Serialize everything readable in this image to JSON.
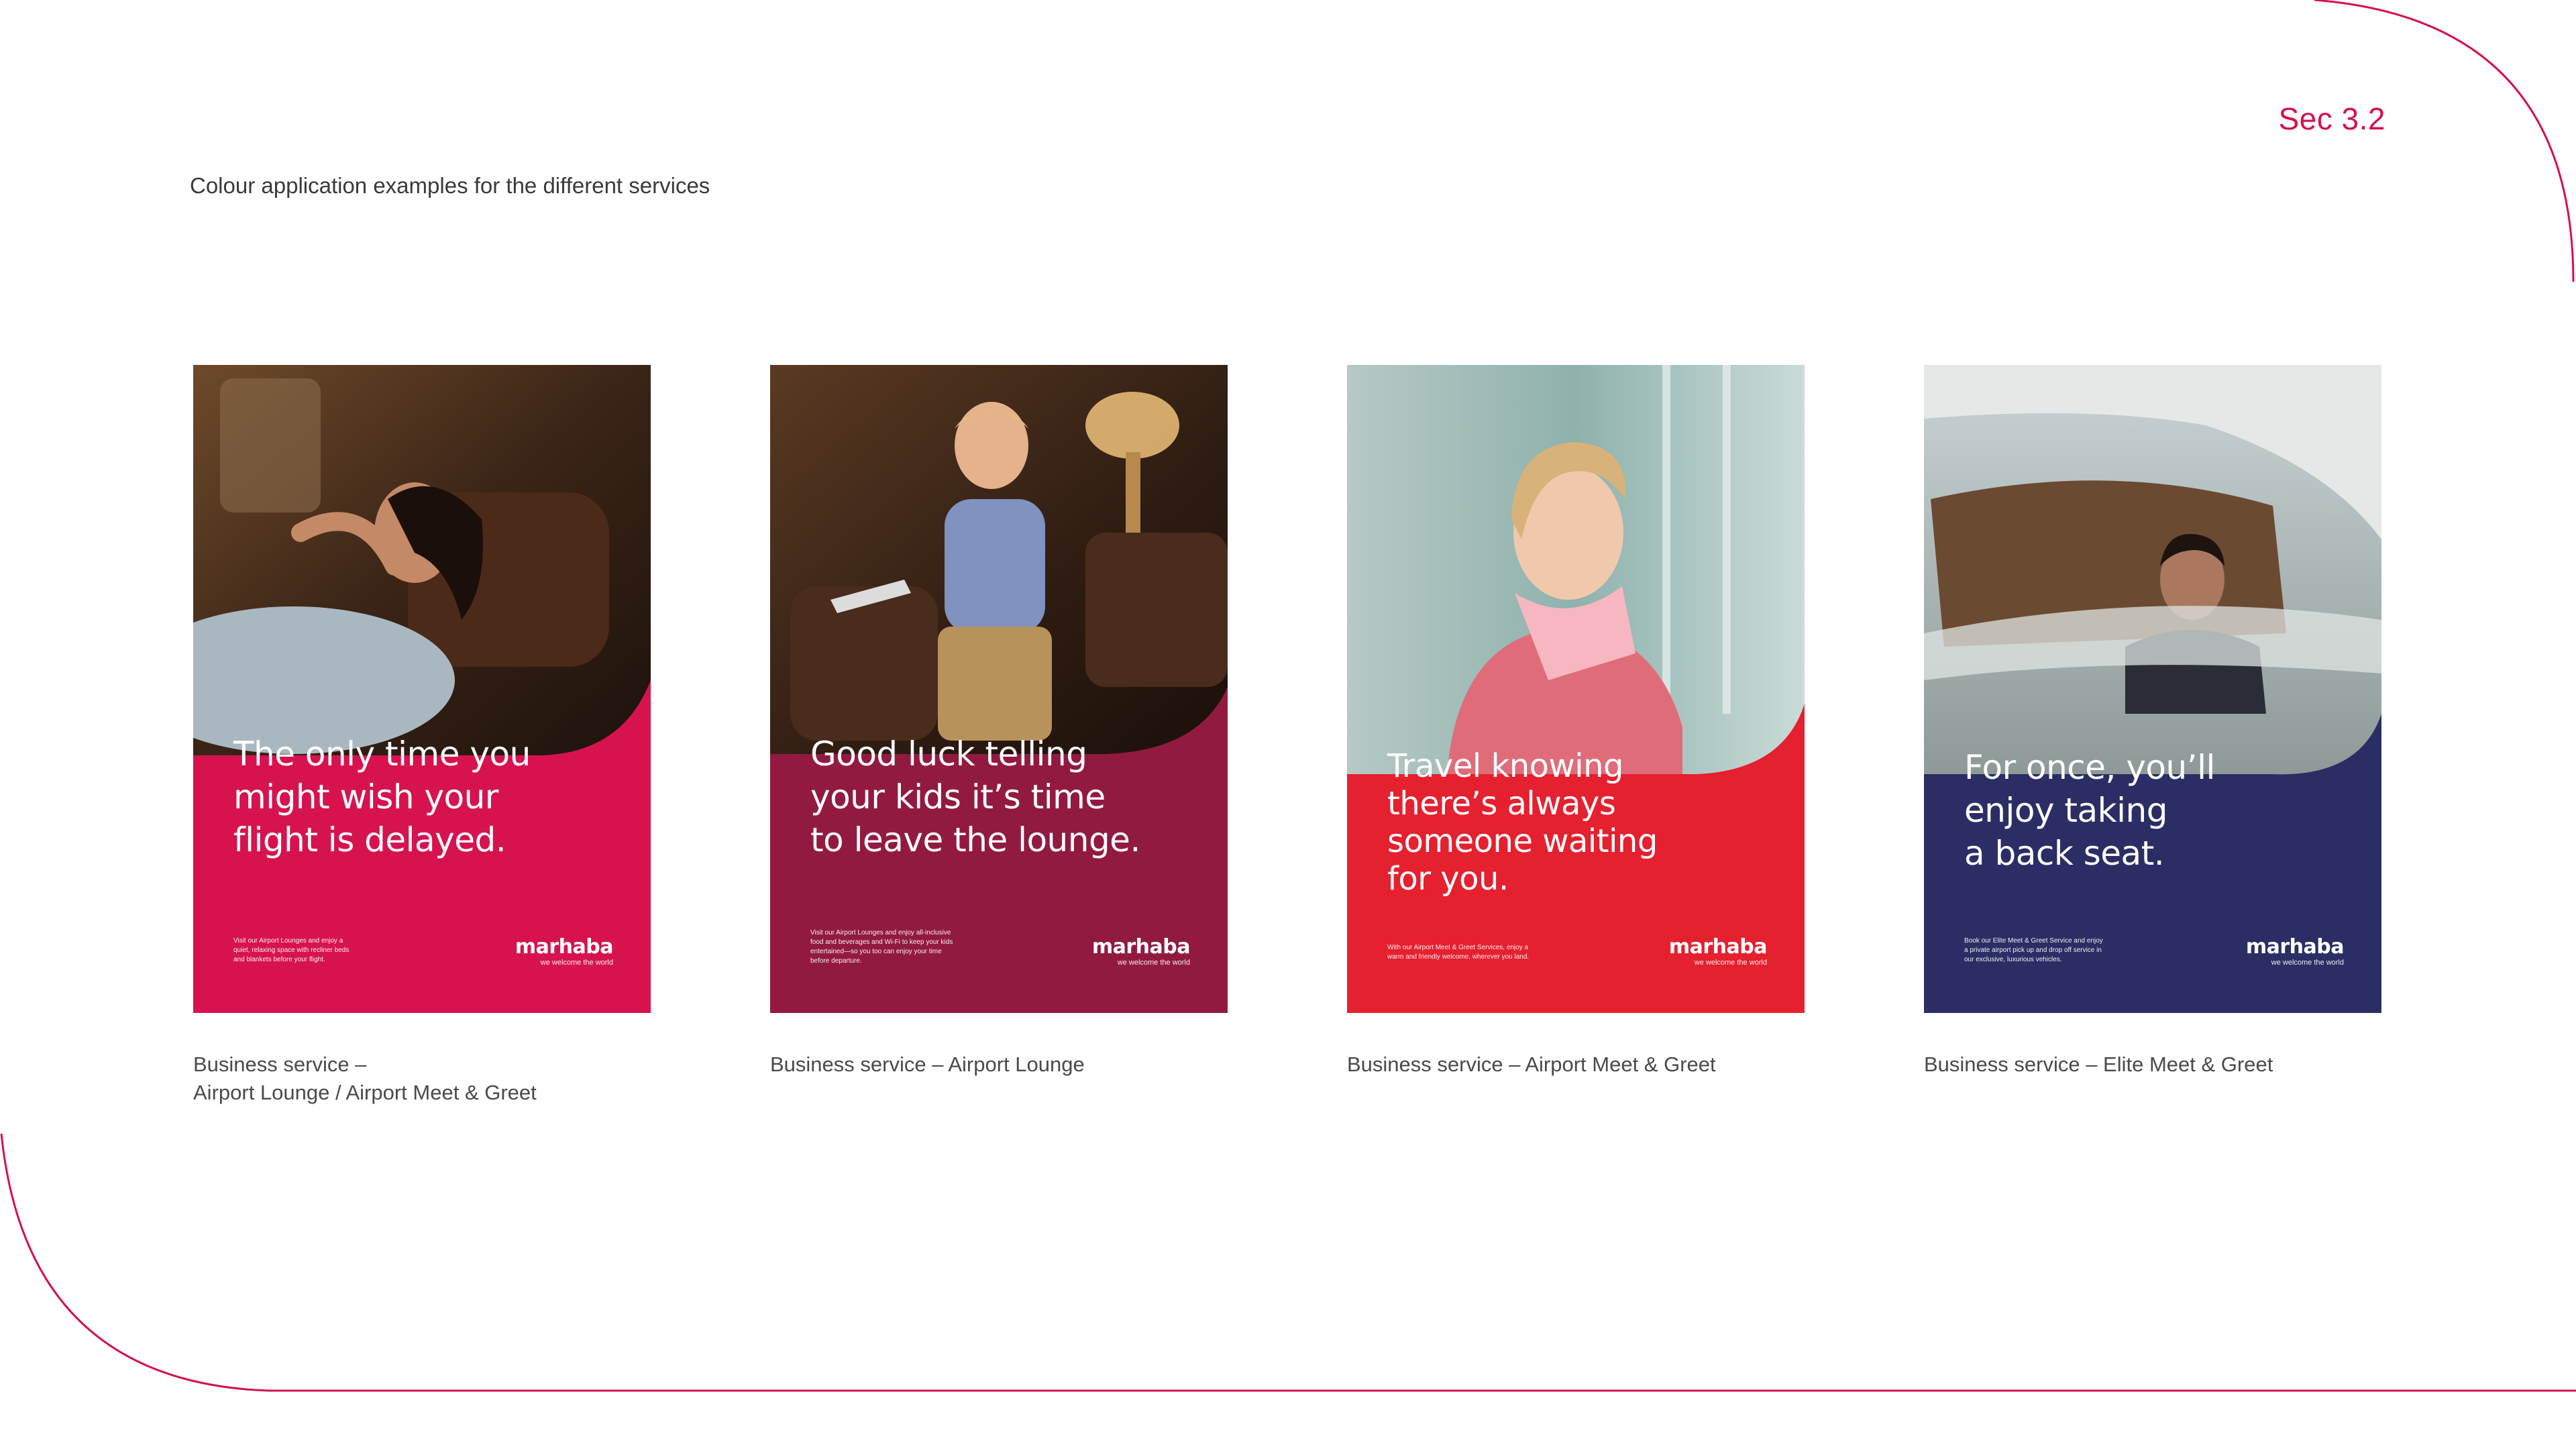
{
  "header": {
    "section": "Sec 3.2",
    "subtitle": "Colour application examples for the different services"
  },
  "colors": {
    "accent": "#d4124b",
    "poster_1_bg": "#d7134f",
    "poster_2_bg": "#921a40",
    "poster_3_bg": "#e5202f",
    "poster_4_bg": "#2b2e64"
  },
  "posters": [
    {
      "headline": "The only time you\nmight wish your\nflight is delayed.",
      "body": "Visit our Airport Lounges and enjoy a\nquiet, relaxing space with recliner beds\nand blankets before your flight.",
      "logo": "marhaba",
      "tagline": "we welcome the world",
      "caption": "Business service –\nAirport Lounge / Airport Meet & Greet"
    },
    {
      "headline": "Good luck telling\nyour kids it’s time\nto leave the lounge.",
      "body": "Visit our Airport Lounges and enjoy all-inclusive\nfood and beverages and Wi-Fi to keep your kids\nentertained—so you too can enjoy your time\nbefore departure.",
      "logo": "marhaba",
      "tagline": "we welcome the world",
      "caption": "Business service – Airport Lounge"
    },
    {
      "headline": "Travel knowing\nthere’s always\nsomeone waiting\nfor you.",
      "body": "With our Airport Meet & Greet Services, enjoy a\nwarm and friendly welcome, wherever you land.",
      "logo": "marhaba",
      "tagline": "we welcome the world",
      "caption": "Business service – Airport Meet & Greet"
    },
    {
      "headline": "For once, you’ll\nenjoy taking\na back seat.",
      "body": "Book our Elite Meet & Greet Service and enjoy\na private airport pick up and drop off service in\nour exclusive, luxurious vehicles.",
      "logo": "marhaba",
      "tagline": "we welcome the world",
      "caption": "Business service – Elite Meet & Greet"
    }
  ]
}
